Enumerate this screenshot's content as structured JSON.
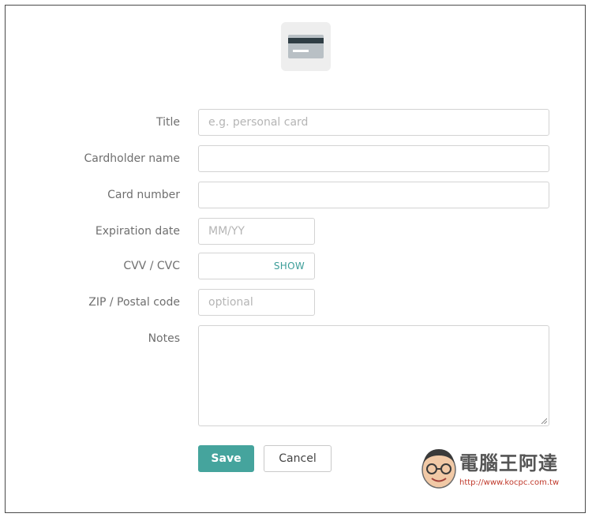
{
  "header": {
    "icon": "credit-card-icon"
  },
  "form": {
    "title": {
      "label": "Title",
      "placeholder": "e.g. personal card",
      "value": ""
    },
    "cardholder": {
      "label": "Cardholder name",
      "placeholder": "",
      "value": ""
    },
    "card_number": {
      "label": "Card number",
      "placeholder": "",
      "value": ""
    },
    "expiration": {
      "label": "Expiration date",
      "placeholder": "MM/YY",
      "value": ""
    },
    "cvv": {
      "label": "CVV / CVC",
      "placeholder": "",
      "value": "",
      "toggle_label": "SHOW"
    },
    "zip": {
      "label": "ZIP / Postal code",
      "placeholder": "optional",
      "value": ""
    },
    "notes": {
      "label": "Notes",
      "value": ""
    }
  },
  "actions": {
    "save_label": "Save",
    "cancel_label": "Cancel"
  },
  "watermark": {
    "title": "電腦王阿達",
    "url": "http://www.kocpc.com.tw"
  },
  "colors": {
    "accent": "#45a49d",
    "link": "#3b9d98",
    "label": "#6f6f6f",
    "border": "#d3d3d3"
  }
}
